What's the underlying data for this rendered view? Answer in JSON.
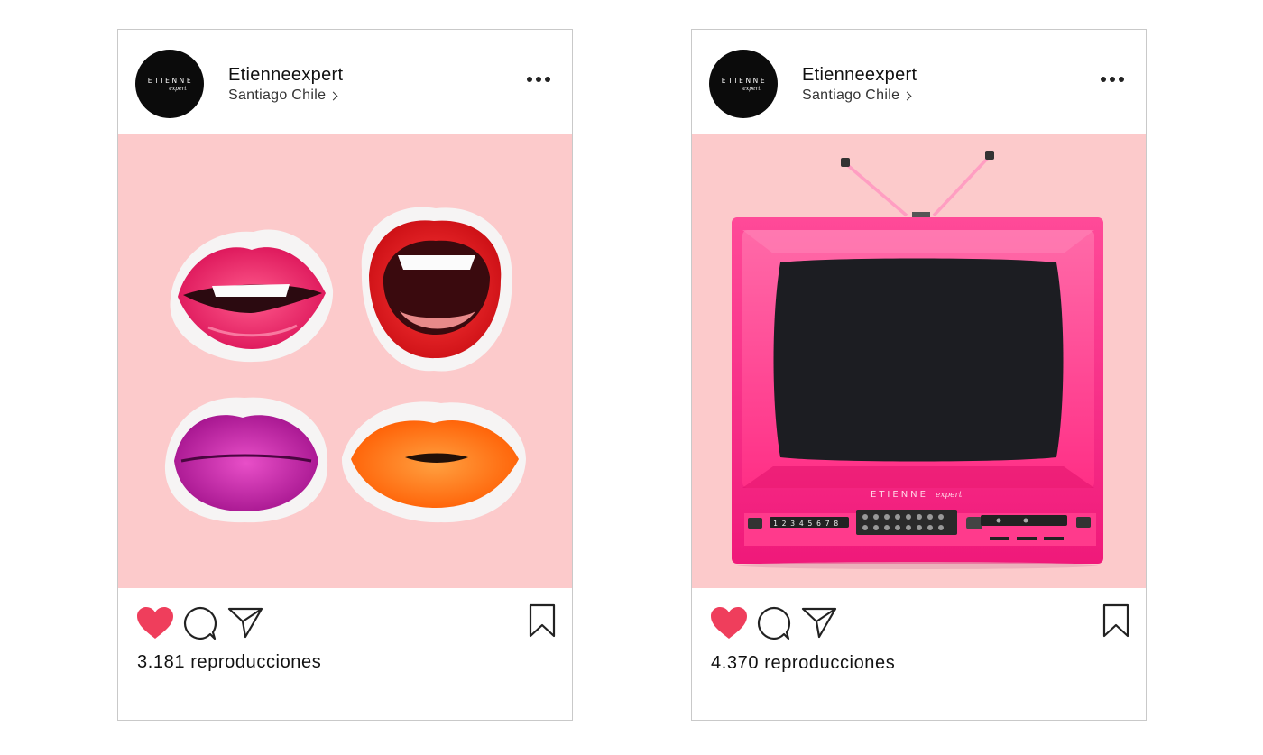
{
  "posts": [
    {
      "avatar": {
        "line1": "ETIENNE",
        "line2": "expert"
      },
      "username": "Etienneexpert",
      "location": "Santiago Chile",
      "views_text": "3.181 reproducciones",
      "media": "lips-collage"
    },
    {
      "avatar": {
        "line1": "ETIENNE",
        "line2": "expert"
      },
      "username": "Etienneexpert",
      "location": "Santiago Chile",
      "views_text": "4.370 reproducciones",
      "media": "pink-television",
      "tv": {
        "brand": "ETIENNE",
        "brand_script": "expert",
        "channels": "1 2 3 4 5 6 7 8"
      }
    }
  ],
  "icons": [
    "more-icon",
    "heart-icon",
    "comment-icon",
    "share-icon",
    "bookmark-icon",
    "chevron-right-icon"
  ],
  "colors": {
    "media_bg": "#fccacb",
    "heart": "#ef3e5c",
    "tv_pink": "#ff2f86",
    "screen": "#1c1d22"
  }
}
